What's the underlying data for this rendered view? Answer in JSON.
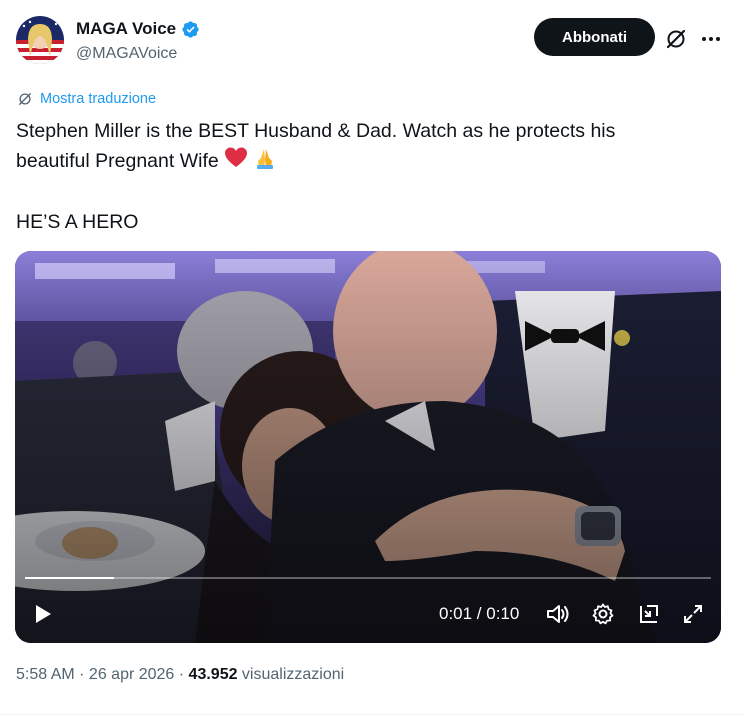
{
  "author": {
    "display_name": "MAGA Voice",
    "handle": "@MAGAVoice",
    "verified_icon": "verified-badge-icon",
    "verified_color": "#1d9bf0"
  },
  "header": {
    "subscribe_label": "Abbonati",
    "grok_icon": "grok-icon",
    "more_icon": "more-horizontal-icon"
  },
  "translate": {
    "label": "Mostra traduzione",
    "icon": "translate-icon"
  },
  "post": {
    "line1": "Stephen Miller is the BEST Husband & Dad. Watch as he protects his",
    "line2": "beautiful Pregnant Wife",
    "line2_emojis": "❤️ 🙏",
    "line3": "HE’S A HERO"
  },
  "video": {
    "time_readout": "0:01 / 0:10",
    "progress": 0.13,
    "icons": [
      "play-icon",
      "volume-icon",
      "settings-icon",
      "picture-in-picture-icon",
      "fullscreen-icon"
    ]
  },
  "meta": {
    "time": "5:58 AM",
    "separator": " · ",
    "date": "26 apr 2026",
    "views_count": "43.952",
    "views_label": " visualizzazioni"
  },
  "colors": {
    "text_primary": "#0f1419",
    "text_secondary": "#536471",
    "link": "#1d9bf0",
    "button_bg": "#0f1419"
  }
}
